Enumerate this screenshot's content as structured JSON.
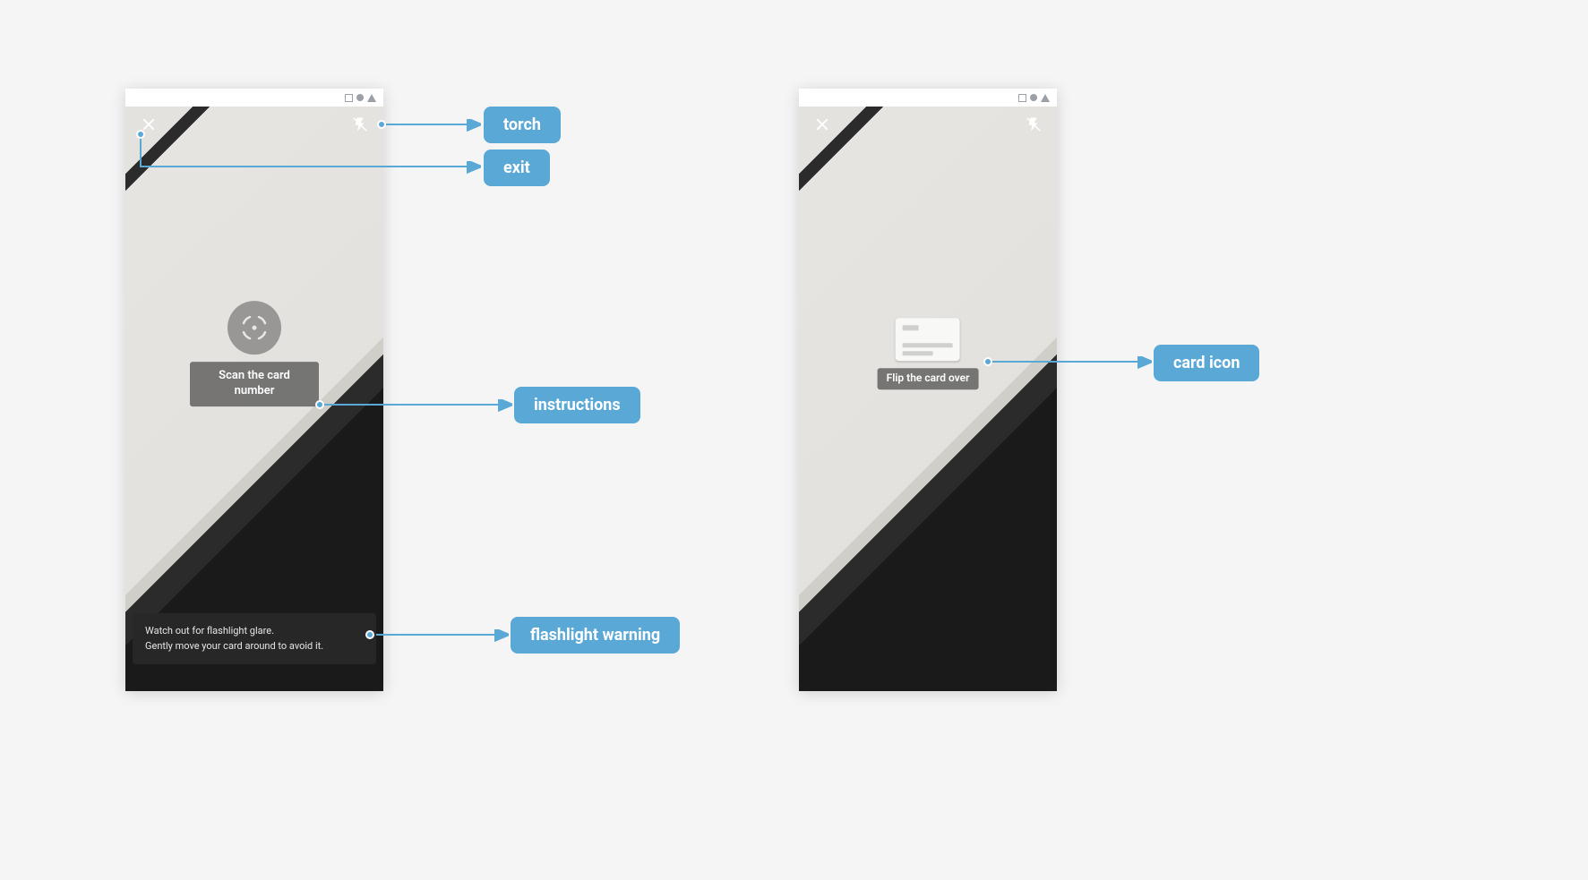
{
  "labels": {
    "torch": "torch",
    "exit": "exit",
    "instructions": "instructions",
    "flashlight_warning": "flashlight warning",
    "card_icon": "card icon"
  },
  "screen1": {
    "instruction": "Scan the card number",
    "warning_line1": "Watch out for flashlight glare.",
    "warning_line2": "Gently move your card around to avoid it."
  },
  "screen2": {
    "instruction": "Flip the card over"
  },
  "colors": {
    "accent": "#5aa8d6"
  }
}
